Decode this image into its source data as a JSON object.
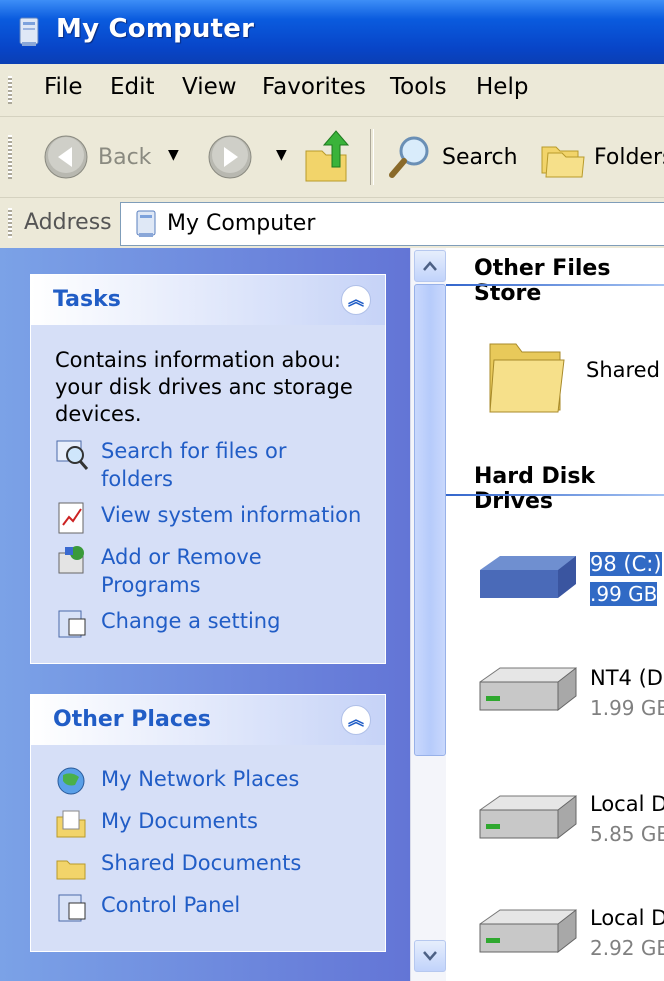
{
  "window": {
    "title": "My Computer"
  },
  "menu": [
    "File",
    "Edit",
    "View",
    "Favorites",
    "Tools",
    "Help"
  ],
  "toolbar": {
    "back": "Back",
    "search": "Search",
    "folders": "Folders"
  },
  "address": {
    "label": "Address",
    "value": "My Computer"
  },
  "tasks": {
    "title": "Tasks",
    "description": "Contains information abou: your disk drives anc storage devices.",
    "links": [
      "Search for files or folders",
      "View system information",
      "Add or Remove Programs",
      "Change a setting"
    ]
  },
  "other_places": {
    "title": "Other Places",
    "links": [
      "My Network Places",
      "My Documents",
      "Shared Documents",
      "Control Panel"
    ]
  },
  "groups": {
    "other_files": "Other Files Store",
    "hard_disks": "Hard Disk Drives"
  },
  "items": {
    "shared": "Shared",
    "drives": [
      {
        "name": "98 (C:)",
        "size": ".99 GB"
      },
      {
        "name": "NT4 (D",
        "size": "1.99 GB"
      },
      {
        "name": "Local D",
        "size": "5.85 GB"
      },
      {
        "name": "Local D",
        "size": "2.92 GB"
      }
    ]
  }
}
